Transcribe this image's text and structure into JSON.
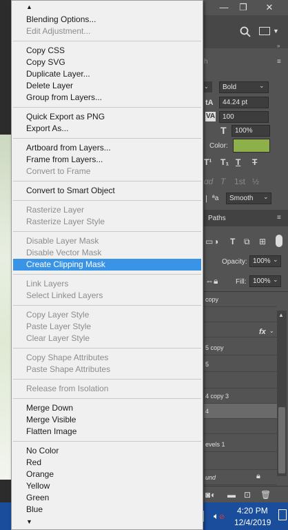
{
  "menu": {
    "scroll_up": "▲",
    "scroll_down": "▼",
    "groups": [
      [
        {
          "label": "Blending Options...",
          "enabled": true
        },
        {
          "label": "Edit Adjustment...",
          "enabled": false
        }
      ],
      [
        {
          "label": "Copy CSS",
          "enabled": true
        },
        {
          "label": "Copy SVG",
          "enabled": true
        },
        {
          "label": "Duplicate Layer...",
          "enabled": true
        },
        {
          "label": "Delete Layer",
          "enabled": true
        },
        {
          "label": "Group from Layers...",
          "enabled": true
        }
      ],
      [
        {
          "label": "Quick Export as PNG",
          "enabled": true
        },
        {
          "label": "Export As...",
          "enabled": true
        }
      ],
      [
        {
          "label": "Artboard from Layers...",
          "enabled": true
        },
        {
          "label": "Frame from Layers...",
          "enabled": true
        },
        {
          "label": "Convert to Frame",
          "enabled": false
        }
      ],
      [
        {
          "label": "Convert to Smart Object",
          "enabled": true
        }
      ],
      [
        {
          "label": "Rasterize Layer",
          "enabled": false
        },
        {
          "label": "Rasterize Layer Style",
          "enabled": false
        }
      ],
      [
        {
          "label": "Disable Layer Mask",
          "enabled": false
        },
        {
          "label": "Disable Vector Mask",
          "enabled": false
        },
        {
          "label": "Create Clipping Mask",
          "enabled": true,
          "highlighted": true
        }
      ],
      [
        {
          "label": "Link Layers",
          "enabled": false
        },
        {
          "label": "Select Linked Layers",
          "enabled": false
        }
      ],
      [
        {
          "label": "Copy Layer Style",
          "enabled": false
        },
        {
          "label": "Paste Layer Style",
          "enabled": false
        },
        {
          "label": "Clear Layer Style",
          "enabled": false
        }
      ],
      [
        {
          "label": "Copy Shape Attributes",
          "enabled": false
        },
        {
          "label": "Paste Shape Attributes",
          "enabled": false
        }
      ],
      [
        {
          "label": "Release from Isolation",
          "enabled": false
        }
      ],
      [
        {
          "label": "Merge Down",
          "enabled": true
        },
        {
          "label": "Merge Visible",
          "enabled": true
        },
        {
          "label": "Flatten Image",
          "enabled": true
        }
      ],
      [
        {
          "label": "No Color",
          "enabled": true
        },
        {
          "label": "Red",
          "enabled": true
        },
        {
          "label": "Orange",
          "enabled": true
        },
        {
          "label": "Yellow",
          "enabled": true
        },
        {
          "label": "Green",
          "enabled": true
        },
        {
          "label": "Blue",
          "enabled": true
        }
      ]
    ]
  },
  "photoshop": {
    "window_buttons": {
      "minimize": "—",
      "restore": "❐",
      "close": "✕"
    },
    "panel_tab": "h",
    "font_style": "Bold",
    "font_size": "44.24 pt",
    "tracking": "100",
    "vertical_scale": "100%",
    "color_label": "Color:",
    "text_color": "#8db04a",
    "anti_alias_label": "a",
    "anti_alias": "Smooth",
    "paths_tab": "Paths",
    "opacity_label": "Opacity:",
    "opacity": "100%",
    "fill_label": "Fill:",
    "fill": "100%",
    "layers": [
      {
        "name": "copy",
        "selected": false
      },
      {
        "name": "",
        "selected": false
      },
      {
        "name": "",
        "selected": false,
        "fx": true
      },
      {
        "name": "5 copy",
        "selected": false
      },
      {
        "name": "5",
        "selected": false
      },
      {
        "name": "",
        "selected": false
      },
      {
        "name": "4 copy 3",
        "selected": false
      },
      {
        "name": "4",
        "selected": true
      },
      {
        "name": "",
        "selected": false
      },
      {
        "name": "evels 1",
        "selected": false
      },
      {
        "name": "",
        "selected": false
      },
      {
        "name": "und",
        "selected": false
      }
    ],
    "fx_label": "fx"
  },
  "taskbar": {
    "time": "4:20 PM",
    "date": "12/4/2019"
  },
  "colors": {
    "menu_bg": "#f0f0f0",
    "highlight": "#3a94e6",
    "disabled_text": "#8c8c8c",
    "ps_panel": "#535353",
    "taskbar": "#1a4e9c"
  }
}
